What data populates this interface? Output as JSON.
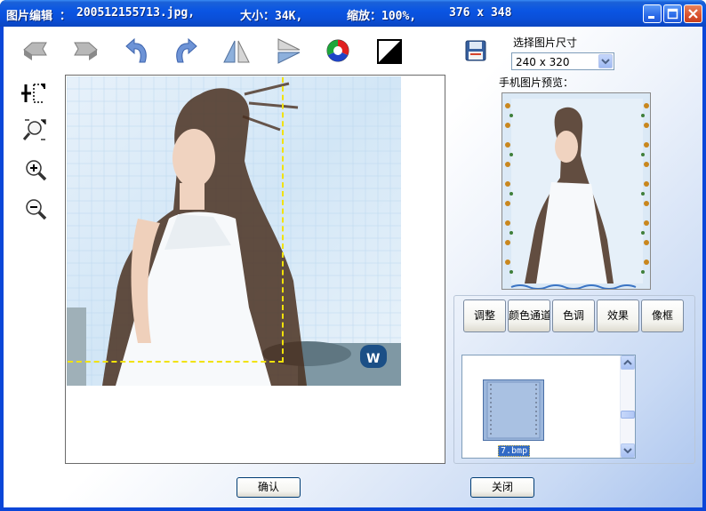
{
  "window": {
    "title_app": "图片编辑 ：",
    "title_file": "200512155713.jpg,",
    "title_size": "大小：34K,",
    "title_zoom": "缩放：100%,",
    "title_dims": "376 x 348"
  },
  "toolbar": {
    "icons": [
      "flip-horizontal-left-icon",
      "flip-horizontal-right-icon",
      "rotate-left-icon",
      "rotate-right-icon",
      "mirror-horizontal-icon",
      "mirror-vertical-icon",
      "color-wheel-icon",
      "invert-icon",
      "save-disk-icon"
    ]
  },
  "sidebar_tools": {
    "icons": [
      "crop-select-icon",
      "zoom-fit-icon",
      "zoom-in-icon",
      "zoom-out-icon"
    ]
  },
  "size": {
    "label": "选择图片尺寸",
    "selected": "240 x 320"
  },
  "preview": {
    "label": "手机图片预览："
  },
  "tabs": [
    "调整",
    "颜色通道",
    "色调",
    "效果",
    "像框"
  ],
  "frames": {
    "items": [
      "7.bmp"
    ],
    "scroll_position": 0.55
  },
  "buttons": {
    "ok": "确认",
    "close": "关闭"
  },
  "colors": {
    "title_bar": "#0a55e3",
    "selection_dash": "#f1e20a",
    "frame_caption_bg": "#316ac5"
  }
}
